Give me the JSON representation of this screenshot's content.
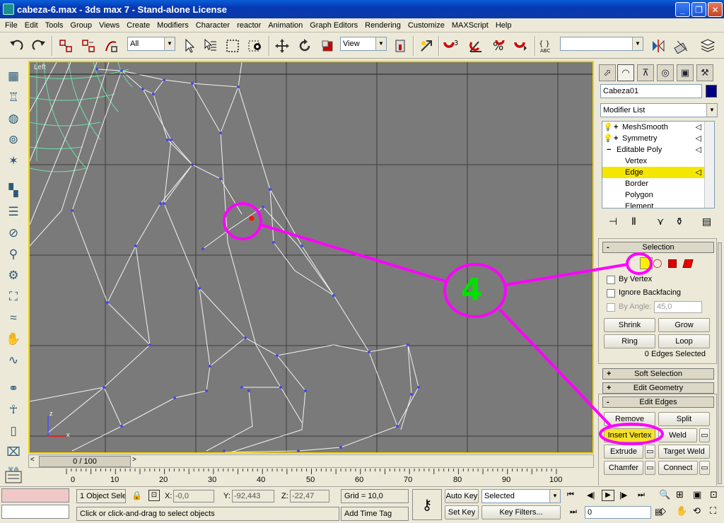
{
  "window": {
    "title": "cabeza-6.max - 3ds max 7 - Stand-alone License",
    "minimize": "_",
    "maximize": "❐",
    "close": "✕"
  },
  "menu": [
    "File",
    "Edit",
    "Tools",
    "Group",
    "Views",
    "Create",
    "Modifiers",
    "Character",
    "reactor",
    "Animation",
    "Graph Editors",
    "Rendering",
    "Customize",
    "MAXScript",
    "Help"
  ],
  "toolbar": {
    "selection_filter": "All",
    "ref_coord": "View",
    "named_sel": ""
  },
  "viewport": {
    "label": "Left",
    "axis_x": "x",
    "axis_z": "z"
  },
  "command_panel": {
    "object_name": "Cabeza01",
    "object_color": "#000080",
    "modifier_list": "Modifier List",
    "stack": [
      {
        "label": "MeshSmooth",
        "level": 0,
        "expander": "+"
      },
      {
        "label": "Symmetry",
        "level": 0,
        "expander": "+"
      },
      {
        "label": "Editable Poly",
        "level": 0,
        "expander": "−"
      },
      {
        "label": "Vertex",
        "level": 1
      },
      {
        "label": "Edge",
        "level": 1,
        "selected": true
      },
      {
        "label": "Border",
        "level": 1
      },
      {
        "label": "Polygon",
        "level": 1
      },
      {
        "label": "Element",
        "level": 1
      }
    ],
    "selection": {
      "title": "Selection",
      "by_vertex": "By Vertex",
      "ignore_backfacing": "Ignore Backfacing",
      "by_angle": "By Angle:",
      "angle_value": "45,0",
      "shrink": "Shrink",
      "grow": "Grow",
      "ring": "Ring",
      "loop": "Loop",
      "status": "0 Edges Selected"
    },
    "soft_selection": "Soft Selection",
    "edit_geometry": "Edit Geometry",
    "edit_edges": {
      "title": "Edit Edges",
      "remove": "Remove",
      "split": "Split",
      "insert_vertex": "Insert Vertex",
      "weld": "Weld",
      "extrude": "Extrude",
      "target_weld": "Target Weld",
      "chamfer": "Chamfer",
      "connect": "Connect"
    }
  },
  "annotation": {
    "number": "4",
    "color": "#ff00ff"
  },
  "timeline": {
    "slider": "0 / 100",
    "ticks": [
      "0",
      "10",
      "20",
      "30",
      "40",
      "50",
      "60",
      "70",
      "80",
      "90",
      "100"
    ]
  },
  "status": {
    "selection": "1 Object Sele",
    "x_label": "X:",
    "x_value": "-0,0",
    "y_label": "Y:",
    "y_value": "-92,443",
    "z_label": "Z:",
    "z_value": "-22,47",
    "grid": "Grid = 10,0",
    "auto_key": "Auto Key",
    "set_key": "Set Key",
    "key_mode": "Selected",
    "key_filters": "Key Filters...",
    "frame": "0",
    "prompt": "Click or click-and-drag to select objects",
    "time_tag": "Add Time Tag"
  }
}
